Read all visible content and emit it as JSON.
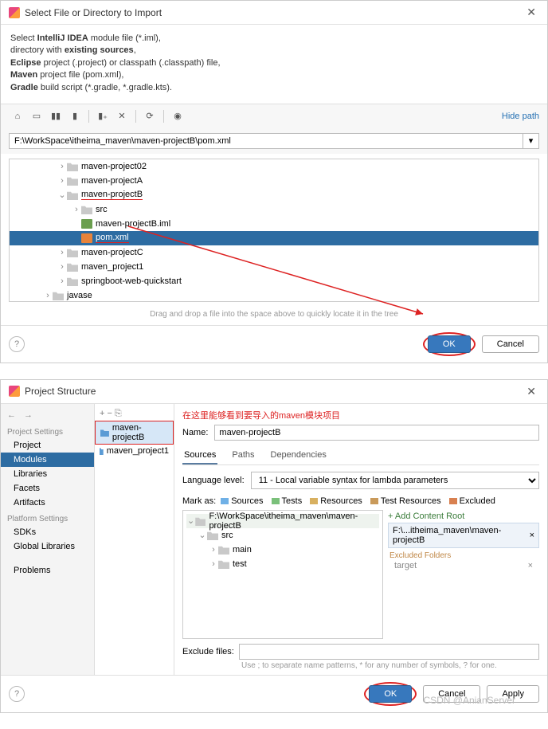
{
  "dialog1": {
    "title": "Select File or Directory to Import",
    "desc_lines": [
      {
        "pre": "Select ",
        "b": "IntelliJ IDEA",
        "post": " module file (*.iml),"
      },
      {
        "pre": "directory with ",
        "b": "existing sources",
        "post": ","
      },
      {
        "pre": "",
        "b": "Eclipse",
        "post": " project (.project) or classpath (.classpath) file,"
      },
      {
        "pre": "",
        "b": "Maven",
        "post": " project file (pom.xml),"
      },
      {
        "pre": "",
        "b": "Gradle",
        "post": " build script (*.gradle, *.gradle.kts)."
      }
    ],
    "hide_path": "Hide path",
    "path_value": "F:\\WorkSpace\\itheima_maven\\maven-projectB\\pom.xml",
    "tree": [
      {
        "indent": 60,
        "chev": "›",
        "icon": "folder",
        "label": "maven-project02"
      },
      {
        "indent": 60,
        "chev": "›",
        "icon": "folder",
        "label": "maven-projectA"
      },
      {
        "indent": 60,
        "chev": "⌄",
        "icon": "folder",
        "label": "maven-projectB",
        "underline": true
      },
      {
        "indent": 78,
        "chev": "›",
        "icon": "folder",
        "label": "src"
      },
      {
        "indent": 78,
        "chev": "",
        "icon": "file-iml",
        "label": "maven-projectB.iml"
      },
      {
        "indent": 78,
        "chev": "",
        "icon": "file-xml",
        "label": "pom.xml",
        "selected": true,
        "underline": true
      },
      {
        "indent": 60,
        "chev": "›",
        "icon": "folder",
        "label": "maven-projectC"
      },
      {
        "indent": 60,
        "chev": "›",
        "icon": "folder",
        "label": "maven_project1"
      },
      {
        "indent": 60,
        "chev": "›",
        "icon": "folder",
        "label": "springboot-web-quickstart"
      },
      {
        "indent": 42,
        "chev": "›",
        "icon": "folder",
        "label": "javase"
      }
    ],
    "drag_hint": "Drag and drop a file into the space above to quickly locate it in the tree",
    "ok": "OK",
    "cancel": "Cancel"
  },
  "dialog2": {
    "title": "Project Structure",
    "red_note": "在这里能够看到要导入的maven模块项目",
    "sidebar": {
      "sec1": "Project Settings",
      "items1": [
        "Project",
        "Modules",
        "Libraries",
        "Facets",
        "Artifacts"
      ],
      "sec2": "Platform Settings",
      "items2": [
        "SDKs",
        "Global Libraries"
      ],
      "sec3": "",
      "items3": [
        "Problems"
      ]
    },
    "modules": [
      {
        "label": "maven-projectB",
        "sel": true,
        "boxed": true
      },
      {
        "label": "maven_project1"
      }
    ],
    "name_label": "Name:",
    "name_value": "maven-projectB",
    "tabs": [
      "Sources",
      "Paths",
      "Dependencies"
    ],
    "lang_label": "Language level:",
    "lang_value": "11 - Local variable syntax for lambda parameters",
    "mark_label": "Mark as:",
    "marks": [
      {
        "label": "Sources",
        "color": "#6fb0e6"
      },
      {
        "label": "Tests",
        "color": "#7ac07a"
      },
      {
        "label": "Resources",
        "color": "#d8b060"
      },
      {
        "label": "Test Resources",
        "color": "#c99a5a"
      },
      {
        "label": "Excluded",
        "color": "#d88050"
      }
    ],
    "content_tree": [
      {
        "indent": 0,
        "chev": "⌄",
        "label": "F:\\WorkSpace\\itheima_maven\\maven-projectB",
        "bg": "#eef3ee"
      },
      {
        "indent": 14,
        "chev": "⌄",
        "label": "src"
      },
      {
        "indent": 28,
        "chev": "›",
        "label": "main"
      },
      {
        "indent": 28,
        "chev": "›",
        "label": "test"
      }
    ],
    "add_root": "+ Add Content Root",
    "root_path": "F:\\...itheima_maven\\maven-projectB",
    "excl_head": "Excluded Folders",
    "excl_item": "target",
    "excl_label": "Exclude files:",
    "excl_hint": "Use ; to separate name patterns, * for any number of symbols, ? for one.",
    "ok": "OK",
    "cancel": "Cancel",
    "apply": "Apply",
    "watermark": "CSDN @AnianServer"
  }
}
